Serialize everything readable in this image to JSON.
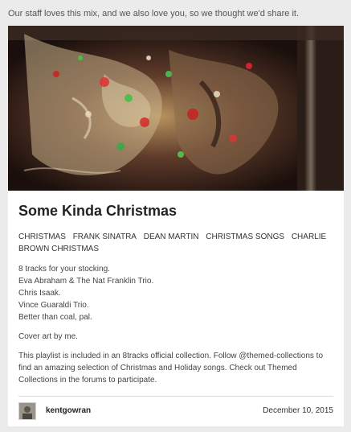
{
  "intro_text": "Our staff loves this mix, and we also love you, so we thought we'd share it.",
  "playlist": {
    "title": "Some Kinda Christmas",
    "tags": [
      "CHRISTMAS",
      "FRANK SINATRA",
      "DEAN MARTIN",
      "CHRISTMAS SONGS",
      "CHARLIE BROWN CHRISTMAS"
    ],
    "description_lines": [
      "8 tracks for your stocking.",
      "Eva Abraham & The Nat Franklin Trio.",
      "Chris Isaak.",
      "Vince Guaraldi Trio.",
      "Better than coal, pal."
    ],
    "cover_note": "Cover art by me.",
    "collection_note": "This playlist is included in an 8tracks official collection. Follow @themed-collections to find an amazing selection of Christmas and Holiday songs. Check out Themed Collections in the forums to participate."
  },
  "footer": {
    "author": "kentgowran",
    "date": "December 10, 2015"
  },
  "colors": {
    "page_bg": "#ebebeb",
    "card_bg": "#ffffff"
  }
}
